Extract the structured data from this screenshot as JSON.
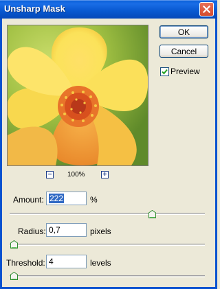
{
  "window": {
    "title": "Unsharp Mask"
  },
  "buttons": {
    "ok": "OK",
    "cancel": "Cancel"
  },
  "preview": {
    "label": "Preview",
    "checked": true,
    "zoom": "100%"
  },
  "amount": {
    "label": "Amount:",
    "value": "222",
    "unit": "%",
    "slider_fraction": 0.74
  },
  "radius": {
    "label": "Radius:",
    "value": "0,7",
    "unit": "pixels",
    "slider_fraction": 0.0
  },
  "threshold": {
    "label": "Threshold:",
    "value": "4",
    "unit": "levels",
    "slider_fraction": 0.0
  },
  "colors": {
    "titlebar": "#0a5fd8",
    "close": "#d44c2e",
    "dialog": "#ece9d8",
    "selection": "#316ac5"
  }
}
